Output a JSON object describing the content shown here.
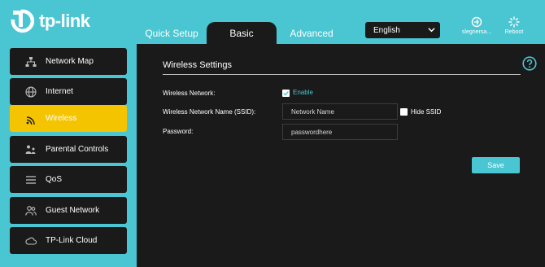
{
  "brand": {
    "logo_text": "tp-link"
  },
  "tabs": [
    {
      "label": "Quick Setup"
    },
    {
      "label": "Basic",
      "active": true
    },
    {
      "label": "Advanced"
    }
  ],
  "language": {
    "selected": "English"
  },
  "header_buttons": {
    "logout_label": "slegnersa...",
    "reboot_label": "Reboot"
  },
  "sidebar": {
    "items": [
      {
        "label": "Network Map",
        "icon": "network-map-icon"
      },
      {
        "label": "Internet",
        "icon": "globe-icon"
      },
      {
        "label": "Wireless",
        "icon": "wifi-icon",
        "active": true
      },
      {
        "label": "Parental Controls",
        "icon": "parental-controls-icon"
      },
      {
        "label": "QoS",
        "icon": "qos-icon"
      },
      {
        "label": "Guest Network",
        "icon": "guest-network-icon"
      },
      {
        "label": "TP-Link Cloud",
        "icon": "cloud-icon"
      }
    ]
  },
  "wireless": {
    "section_title": "Wireless Settings",
    "wireless_network_label": "Wireless Network:",
    "enable_label": "Enable",
    "enable_checked": true,
    "ssid_label": "Wireless Network Name (SSID):",
    "ssid_placeholder": "Network Name",
    "hide_ssid_label": "Hide SSID",
    "hide_ssid_checked": false,
    "password_label": "Password:",
    "password_value": "passwordhere",
    "save_label": "Save"
  },
  "colors": {
    "accent": "#4ac6d2",
    "panel": "#1a1a1a",
    "active_nav": "#f5c400"
  }
}
